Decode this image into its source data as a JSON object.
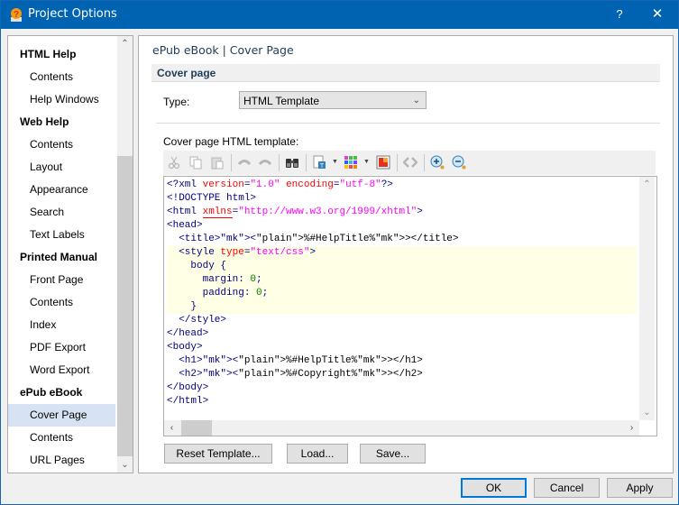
{
  "window": {
    "title": "Project Options",
    "help_label": "?",
    "close_label": "✕"
  },
  "sidebar": {
    "scroll_up": "⌃",
    "scroll_down": "⌄",
    "items": [
      {
        "label": "HTML Help",
        "type": "category"
      },
      {
        "label": "Contents",
        "type": "item"
      },
      {
        "label": "Help Windows",
        "type": "item"
      },
      {
        "label": "Web Help",
        "type": "category"
      },
      {
        "label": "Contents",
        "type": "item"
      },
      {
        "label": "Layout",
        "type": "item"
      },
      {
        "label": "Appearance",
        "type": "item"
      },
      {
        "label": "Search",
        "type": "item"
      },
      {
        "label": "Text Labels",
        "type": "item"
      },
      {
        "label": "Printed Manual",
        "type": "category"
      },
      {
        "label": "Front Page",
        "type": "item"
      },
      {
        "label": "Contents",
        "type": "item"
      },
      {
        "label": "Index",
        "type": "item"
      },
      {
        "label": "PDF Export",
        "type": "item"
      },
      {
        "label": "Word Export",
        "type": "item"
      },
      {
        "label": "ePub eBook",
        "type": "category"
      },
      {
        "label": "Cover Page",
        "type": "item",
        "selected": true
      },
      {
        "label": "Contents",
        "type": "item"
      },
      {
        "label": "URL Pages",
        "type": "item"
      }
    ]
  },
  "content": {
    "breadcrumb": "ePub eBook | Cover Page",
    "section_title": "Cover page",
    "type_label": "Type:",
    "type_value": "HTML Template",
    "template_label": "Cover page HTML template:",
    "toolbar": {
      "icons": [
        "cut-icon",
        "copy-icon",
        "paste-icon",
        "undo-icon",
        "redo-icon",
        "find-icon",
        "insert-field-icon",
        "color-palette-icon",
        "image-icon",
        "tag-icon",
        "zoom-in-icon",
        "zoom-out-icon"
      ]
    },
    "code_lines": [
      "<?xml version=\"1.0\" encoding=\"utf-8\"?>",
      "<!DOCTYPE html>",
      "<html xmlns=\"http://www.w3.org/1999/xhtml\">",
      "<head>",
      "  <title><%#HelpTitle%></title>",
      "  <style type=\"text/css\">",
      "    body {",
      "      margin: 0;",
      "      padding: 0;",
      "    }",
      "  </style>",
      "</head>",
      "<body>",
      "  <h1><%#HelpTitle%></h1>",
      "  <h2><%#Copyright%></h2>",
      "</body>",
      "</html>"
    ],
    "buttons": {
      "reset": "Reset Template...",
      "load": "Load...",
      "save": "Save..."
    }
  },
  "footer": {
    "ok": "OK",
    "cancel": "Cancel",
    "apply": "Apply"
  }
}
